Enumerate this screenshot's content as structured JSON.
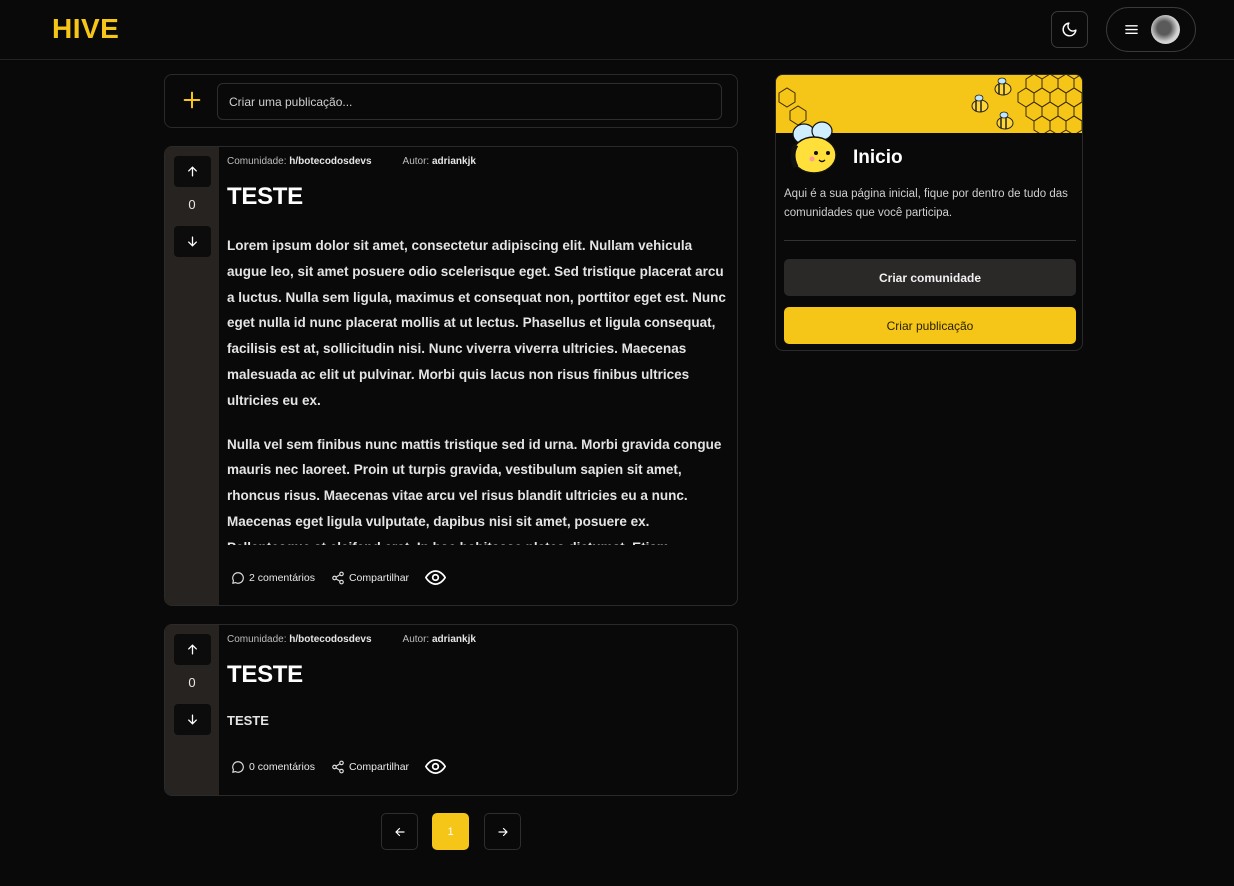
{
  "header": {
    "logo": "HIVE",
    "theme_icon": "moon-icon",
    "menu_icon": "hamburger-icon"
  },
  "create_bar": {
    "placeholder": "Criar uma publicação..."
  },
  "posts": [
    {
      "community_label": "Comunidade:",
      "community": "h/botecodosdevs",
      "author_label": "Autor:",
      "author": "adriankjk",
      "votes": "0",
      "title": "TESTE",
      "paragraphs": [
        "Lorem ipsum dolor sit amet, consectetur adipiscing elit. Nullam vehicula augue leo, sit amet posuere odio scelerisque eget. Sed tristique placerat arcu a luctus. Nulla sem ligula, maximus et consequat non, porttitor eget est. Nunc eget nulla id nunc placerat mollis at ut lectus. Phasellus et ligula consequat, facilisis est at, sollicitudin nisi. Nunc viverra viverra ultricies. Maecenas malesuada ac elit ut pulvinar. Morbi quis lacus non risus finibus ultrices ultricies eu ex.",
        "Nulla vel sem finibus nunc mattis tristique sed id urna. Morbi gravida congue mauris nec laoreet. Proin ut turpis gravida, vestibulum sapien sit amet, rhoncus risus. Maecenas vitae arcu vel risus blandit ultricies eu a nunc. Maecenas eget ligula vulputate, dapibus nisi sit amet, posuere ex. Pellentesque at eleifend erat. In hac habitasse platea dictumst. Etiam vulputate orci pharetra, placerat ex quis, finibus sem."
      ],
      "comments": "2 comentários",
      "share": "Compartilhar"
    },
    {
      "community_label": "Comunidade:",
      "community": "h/botecodosdevs",
      "author_label": "Autor:",
      "author": "adriankjk",
      "votes": "0",
      "title": "TESTE",
      "body": "TESTE",
      "comments": "0 comentários",
      "share": "Compartilhar"
    }
  ],
  "pagination": {
    "current": "1"
  },
  "sidebar": {
    "title": "Inicio",
    "description": "Aqui é a sua página inicial, fique por dentro de tudo das comunidades que você participa.",
    "create_community": "Criar comunidade",
    "create_post": "Criar publicação"
  },
  "colors": {
    "accent": "#f5c518",
    "background": "#0a0909",
    "vote_column": "#272321"
  }
}
